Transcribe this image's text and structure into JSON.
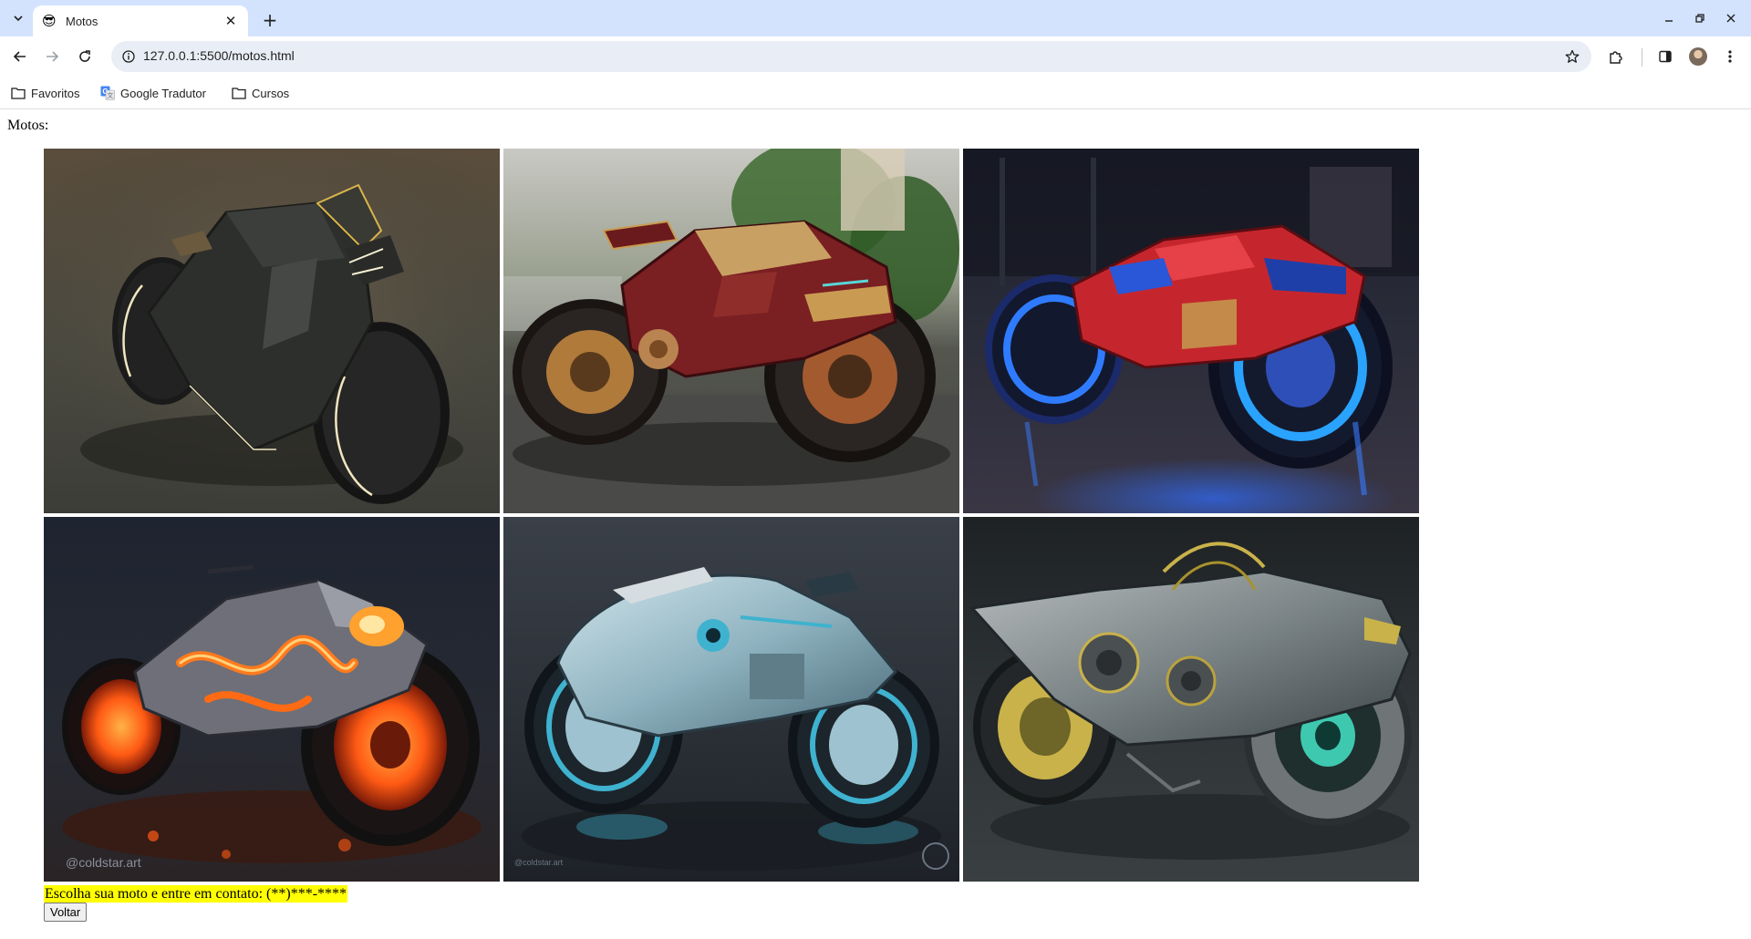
{
  "browser": {
    "tab": {
      "favicon": "😎",
      "title": "Motos"
    },
    "url": "127.0.0.1:5500/motos.html",
    "bookmarks": [
      {
        "label": "Favoritos",
        "icon": "folder-icon"
      },
      {
        "label": "Google Tradutor",
        "icon": "google-translate-icon"
      },
      {
        "label": "Cursos",
        "icon": "folder-icon"
      }
    ]
  },
  "page": {
    "heading": "Motos:",
    "motos": [
      {
        "name": "moto-1",
        "style": "black-angular",
        "accent": "#e8d9a0"
      },
      {
        "name": "moto-2",
        "style": "red-gold",
        "accent": "#c79a4a"
      },
      {
        "name": "moto-3",
        "style": "red-blue-neon",
        "accent": "#2f7bff"
      },
      {
        "name": "moto-4",
        "style": "lava-glow",
        "accent": "#ff6a1a",
        "watermark": "@coldstar.art"
      },
      {
        "name": "moto-5",
        "style": "cyan-chrome",
        "accent": "#3fb2cf",
        "watermark": "@coldstar.art"
      },
      {
        "name": "moto-6",
        "style": "brass-chrome",
        "accent": "#c9b24a"
      }
    ],
    "contact_text": "Escolha sua moto e entre em contato: (**)***-****",
    "back_button": "Voltar"
  }
}
